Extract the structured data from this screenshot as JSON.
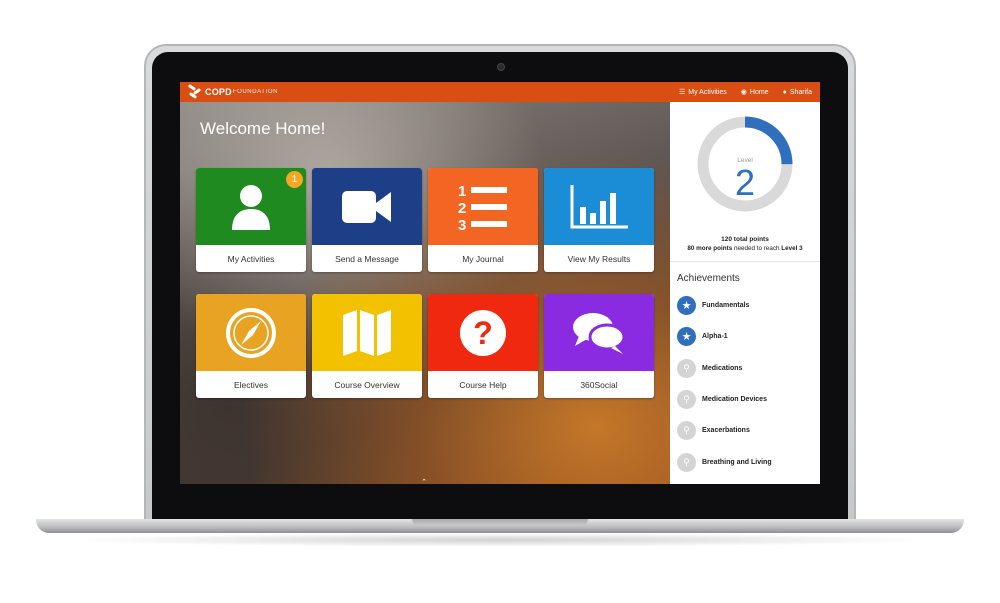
{
  "header": {
    "logo_strong": "COPD",
    "logo_light": "FOUNDATION",
    "nav": [
      {
        "label": "My Activities",
        "icon": "list-icon"
      },
      {
        "label": "Home",
        "icon": "dashboard-icon"
      },
      {
        "label": "Sharifa",
        "icon": "user-icon"
      }
    ]
  },
  "main": {
    "welcome": "Welcome Home!",
    "tiles": [
      {
        "label": "My Activities",
        "icon": "person-icon",
        "color": "#1e8a1f",
        "badge": "1"
      },
      {
        "label": "Send a Message",
        "icon": "video-camera-icon",
        "color": "#1d3f87"
      },
      {
        "label": "My Journal",
        "icon": "numbered-list-icon",
        "color": "#f26522"
      },
      {
        "label": "View My Results",
        "icon": "bar-chart-icon",
        "color": "#1b8dd6"
      },
      {
        "label": "Electives",
        "icon": "compass-icon",
        "color": "#e8a322"
      },
      {
        "label": "Course Overview",
        "icon": "map-icon",
        "color": "#f2c100"
      },
      {
        "label": "Course Help",
        "icon": "question-icon",
        "color": "#f0280f"
      },
      {
        "label": "360Social",
        "icon": "chat-bubbles-icon",
        "color": "#8a2be2"
      }
    ]
  },
  "sidebar": {
    "level_word": "Level",
    "level_value": "2",
    "level_progress": 0.25,
    "points_total": "120 total points",
    "points_needed_amount": "80 more points",
    "points_needed_mid": " needed to reach ",
    "points_needed_target": "Level 3",
    "achievements_title": "Achievements",
    "achievements": [
      {
        "label": "Fundamentals",
        "earned": true
      },
      {
        "label": "Alpha-1",
        "earned": true
      },
      {
        "label": "Medications",
        "earned": false
      },
      {
        "label": "Medication Devices",
        "earned": false
      },
      {
        "label": "Exacerbations",
        "earned": false
      },
      {
        "label": "Breathing and Living",
        "earned": false
      }
    ]
  },
  "colors": {
    "brand": "#d94f13",
    "accent": "#2f6fbe",
    "badge": "#f5a623"
  }
}
